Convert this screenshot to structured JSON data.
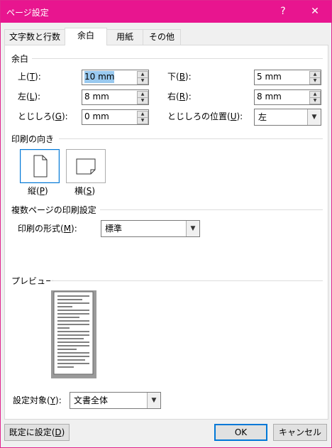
{
  "window": {
    "title": "ページ設定",
    "help": "?",
    "close": "✕"
  },
  "tabs": [
    {
      "label": "文字数と行数",
      "active": false
    },
    {
      "label": "余白",
      "active": true
    },
    {
      "label": "用紙",
      "active": false
    },
    {
      "label": "その他",
      "active": false
    }
  ],
  "margins": {
    "group_label": "余白",
    "top": {
      "label_pre": "上(",
      "key": "T",
      "label_post": "):",
      "value": "10 mm"
    },
    "bottom": {
      "label_pre": "下(",
      "key": "B",
      "label_post": "):",
      "value": "5 mm"
    },
    "left": {
      "label_pre": "左(",
      "key": "L",
      "label_post": "):",
      "value": "8 mm"
    },
    "right": {
      "label_pre": "右(",
      "key": "R",
      "label_post": "):",
      "value": "8 mm"
    },
    "gutter": {
      "label_pre": "とじしろ(",
      "key": "G",
      "label_post": "):",
      "value": "0 mm"
    },
    "gutter_pos": {
      "label_pre": "とじしろの位置(",
      "key": "U",
      "label_post": "):",
      "value": "左"
    }
  },
  "orientation": {
    "group_label": "印刷の向き",
    "portrait": {
      "label_pre": "縦(",
      "key": "P",
      "label_post": ")",
      "selected": true
    },
    "landscape": {
      "label_pre": "横(",
      "key": "S",
      "label_post": ")",
      "selected": false
    }
  },
  "pages": {
    "group_label": "複数ページの印刷設定",
    "label_pre": "印刷の形式(",
    "key": "M",
    "label_post": "):",
    "value": "標準"
  },
  "preview": {
    "group_label": "プレビュー"
  },
  "apply": {
    "label_pre": "設定対象(",
    "key": "Y",
    "label_post": "):",
    "value": "文書全体"
  },
  "buttons": {
    "default_pre": "既定に設定(",
    "default_key": "D",
    "default_post": ")",
    "ok": "OK",
    "cancel": "キャンセル"
  },
  "colors": {
    "titlebar": "#e8158f",
    "selection": "#99c9ef",
    "focus": "#0078d7"
  }
}
